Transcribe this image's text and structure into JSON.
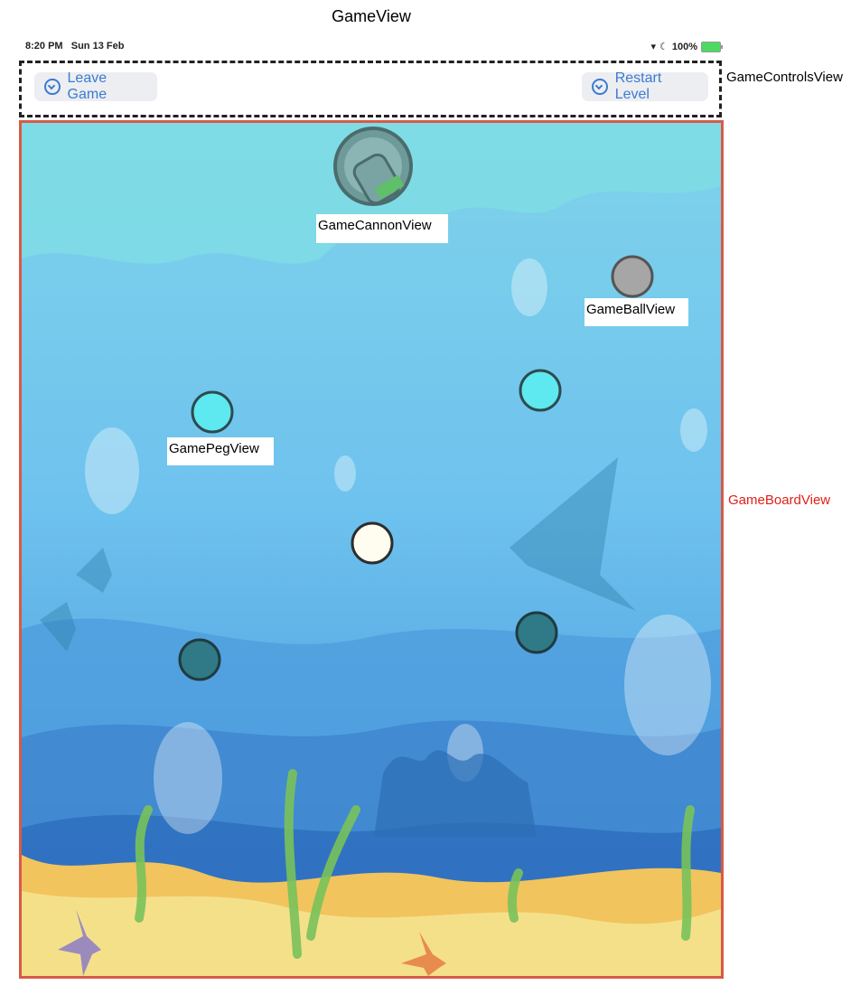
{
  "page": {
    "title": "GameView"
  },
  "status_bar": {
    "time": "8:20 PM",
    "date": "Sun 13 Feb",
    "battery": "100%"
  },
  "controls": {
    "label": "GameControlsView",
    "leave_label": "Leave Game",
    "restart_label": "Restart Level"
  },
  "board": {
    "label": "GameBoardView",
    "cannon_tag": "GameCannonView",
    "ball_tag": "GameBallView",
    "peg_tag": "GamePegView"
  },
  "colors": {
    "accent": "#3b7ad3",
    "board_border": "#d85a46",
    "peg_cyan": "#5ee8f0",
    "peg_dark": "#2f7a86",
    "peg_white": "#fffcf0",
    "ball_gray": "#a6a6a6"
  }
}
